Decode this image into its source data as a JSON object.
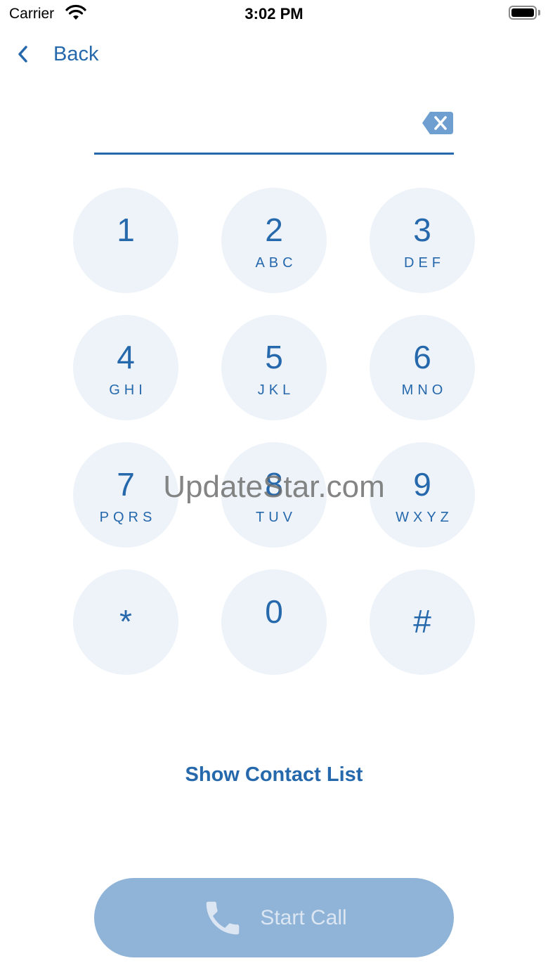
{
  "status_bar": {
    "carrier": "Carrier",
    "time": "3:02 PM"
  },
  "nav": {
    "back_label": "Back"
  },
  "number_field": {
    "value": ""
  },
  "keypad": [
    {
      "digit": "1",
      "letters": ""
    },
    {
      "digit": "2",
      "letters": "ABC"
    },
    {
      "digit": "3",
      "letters": "DEF"
    },
    {
      "digit": "4",
      "letters": "GHI"
    },
    {
      "digit": "5",
      "letters": "JKL"
    },
    {
      "digit": "6",
      "letters": "MNO"
    },
    {
      "digit": "7",
      "letters": "PQRS"
    },
    {
      "digit": "8",
      "letters": "TUV"
    },
    {
      "digit": "9",
      "letters": "WXYZ"
    },
    {
      "digit": "*",
      "letters": ""
    },
    {
      "digit": "0",
      "letters": ""
    },
    {
      "digit": "#",
      "letters": ""
    }
  ],
  "watermark": "UpdateStar.com",
  "actions": {
    "show_contacts": "Show Contact List",
    "start_call": "Start Call"
  },
  "colors": {
    "accent": "#2668ac",
    "key_background": "#edf3f9",
    "call_button_disabled": "#90b3d8"
  },
  "icons": {
    "back": "chevron-left-icon",
    "delete": "backspace-icon",
    "call": "phone-icon"
  }
}
